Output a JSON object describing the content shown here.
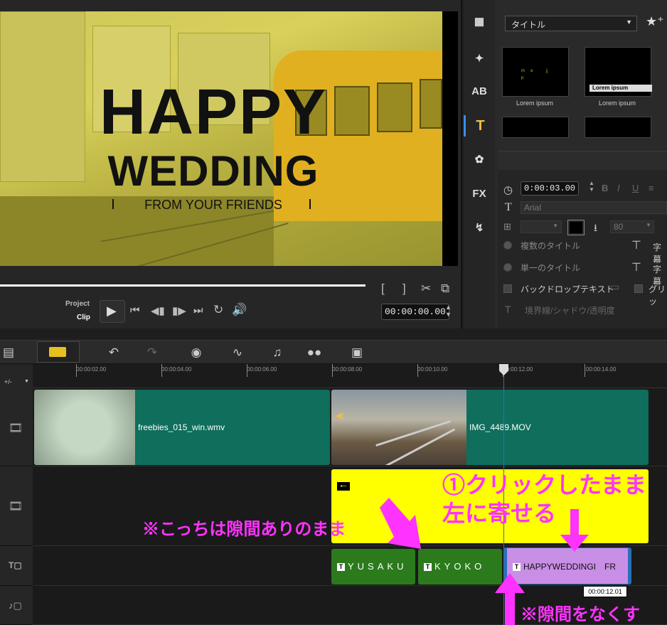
{
  "preview": {
    "title_line1": "HAPPY",
    "title_line2": "WEDDING",
    "title_line3": "FROM YOUR FRIENDS",
    "mode_project": "Project",
    "mode_clip": "Clip",
    "timecode": "00:00:00.00"
  },
  "library": {
    "category": "タイトル",
    "thumbnails": [
      {
        "caption": "Lorem ipsum"
      },
      {
        "caption": "Lorem ipsum",
        "overlay": "Lorem ipsum"
      }
    ],
    "thumb1_text": "ᵐᵉ i ᵖ",
    "side_icons": [
      "media-icon",
      "instant-project-icon",
      "transition-icon",
      "title-icon",
      "graphic-icon",
      "filter-icon",
      "path-icon"
    ],
    "duration": "0:00:03.00",
    "font": "Arial",
    "font_size": "80",
    "text_color": "#000000",
    "buttons": [
      "B",
      "I",
      "U"
    ],
    "options": {
      "multi_title": "複数のタイトル",
      "single_title": "単一のタイトル",
      "backdrop_text": "バックドロップテキスト",
      "grid": "グリッ",
      "border_shadow": "境界線/シャドウ/透明度",
      "subtitle1": "字幕",
      "subtitle2": "字幕"
    },
    "fx_label": "FX",
    "ab_label": "AB"
  },
  "toolbar": {
    "icons": [
      "storyboard-view-icon",
      "timeline-view-icon",
      "undo-icon",
      "redo-icon",
      "record-capture-icon",
      "sound-mixer-icon",
      "auto-music-icon",
      "motion-tracking-icon",
      "subtitle-editor-icon"
    ]
  },
  "ruler": {
    "labels": [
      "00:00:02.00",
      "00:00:04.00",
      "00:00:06.00",
      "00:00:08.00",
      "00:00:10.00",
      "00:00:12.00",
      "00:00:14.00"
    ],
    "zoom_label": "+/-"
  },
  "tracks": {
    "video_clips": [
      "freebies_015_win.wmv",
      "IMG_4489.MOV"
    ],
    "title_clips": [
      "YUSAKU",
      "KYOKO",
      "HAPPYWEDDINGI　FR"
    ],
    "title_badge": "T",
    "tooltip_time": "00:00:12.01"
  },
  "annotations": {
    "step1_line1": "①クリックしたまま",
    "step1_line2": "左に寄せる",
    "note_gap_remains": "※こっちは隙間ありのまま",
    "note_close_gap": "※隙間をなくす"
  },
  "colors": {
    "annotation": "#ff33ff",
    "overlay_clip": "#ffff00",
    "selected_title_clip": "#c98ee6",
    "title_clip": "#2b7a1c",
    "video_clip": "#0f6e5c",
    "playhead": "#2a6fb8"
  }
}
